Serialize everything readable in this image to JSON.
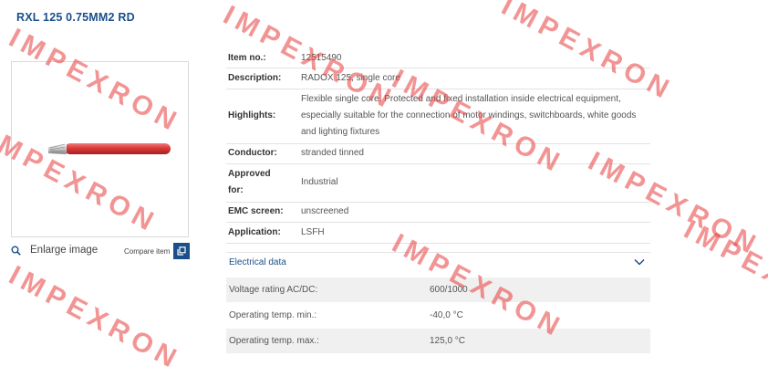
{
  "product": {
    "title": "RXL 125 0.75MM2 RD"
  },
  "gallery": {
    "enlarge_label": "Enlarge image",
    "compare_label": "Compare item"
  },
  "specs": [
    {
      "key": "Item no.:",
      "value": "12515490"
    },
    {
      "key": "Description:",
      "value": "RADOX 125, single core"
    },
    {
      "key": "Highlights:",
      "value": "Flexible single core. Protected and fixed installation inside electrical equipment, especially suitable for the connection of motor windings, switchboards, white goods and lighting fixtures"
    },
    {
      "key": "Conductor:",
      "value": "stranded tinned"
    },
    {
      "key": "Approved for:",
      "value": "Industrial"
    },
    {
      "key": "EMC screen:",
      "value": "unscreened"
    },
    {
      "key": "Application:",
      "value": "LSFH"
    }
  ],
  "electrical": {
    "heading": "Electrical data",
    "rows": [
      {
        "label": "Voltage rating AC/DC:",
        "value": "600/1000"
      },
      {
        "label": "Operating temp. min.:",
        "value": "-40,0 °C"
      },
      {
        "label": "Operating temp. max.:",
        "value": "125,0 °C"
      }
    ]
  },
  "watermark": {
    "text": "IMPEXRON"
  },
  "colors": {
    "brand": "#1b4f8a",
    "cable": "#d93a3a",
    "watermark": "#e83c3c"
  }
}
